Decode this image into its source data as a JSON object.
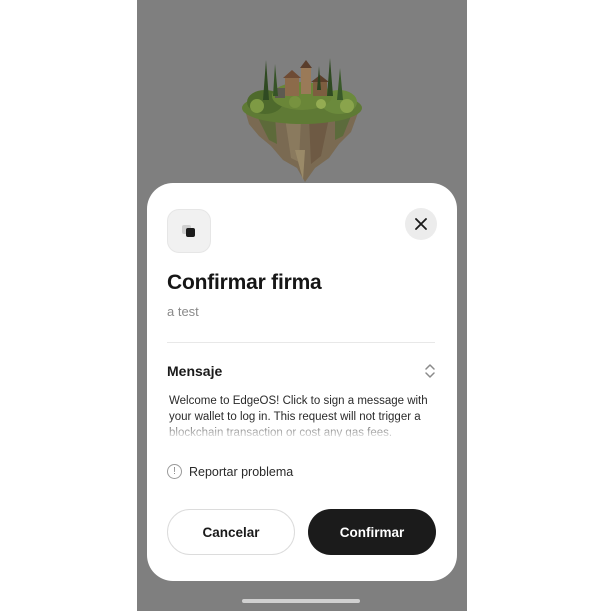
{
  "modal": {
    "title": "Confirmar firma",
    "subtitle": "a test",
    "message_section_label": "Mensaje",
    "message_text": "Welcome to EdgeOS! Click to sign a message with your wallet to log in. This request will not trigger a blockchain transaction or cost any gas fees.",
    "report_label": "Reportar problema",
    "cancel_label": "Cancelar",
    "confirm_label": "Confirmar"
  },
  "icons": {
    "app_icon": "app-icon",
    "close": "close-icon",
    "expand_toggle": "chevron-up-down-icon",
    "report": "info-circle-icon"
  },
  "colors": {
    "backdrop": "#7f7f7f",
    "sheet": "#ffffff",
    "primary_button": "#1b1b1b",
    "close_button_bg": "#ececec"
  }
}
